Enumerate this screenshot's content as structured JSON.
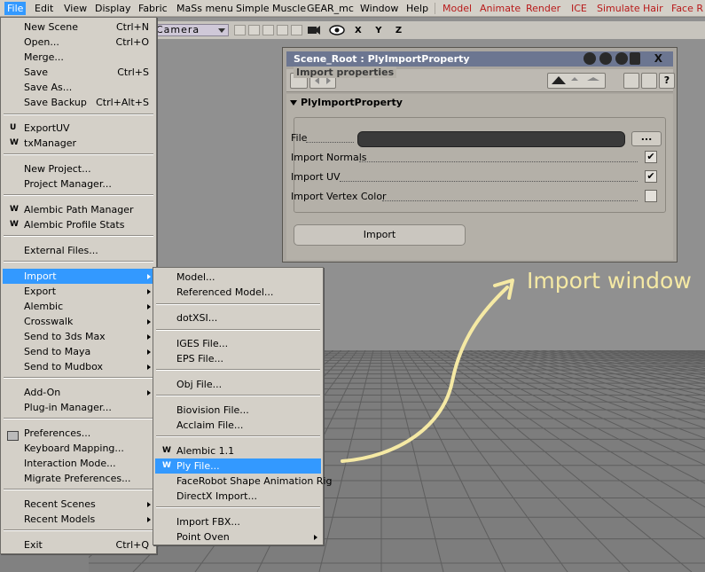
{
  "menubar": {
    "items": [
      "File",
      "Edit",
      "View",
      "Display",
      "Fabric",
      "MaSs menu",
      "Simple Muscle",
      "GEAR_mc",
      "Window",
      "Help"
    ],
    "red_items": [
      "Model",
      "Animate",
      "Render",
      "ICE",
      "Simulate",
      "Hair",
      "Face R"
    ]
  },
  "viewport": {
    "camera": "Camera",
    "axes": "X Y Z"
  },
  "file_menu": {
    "items": [
      {
        "label": "New Scene",
        "shortcut": "Ctrl+N"
      },
      {
        "label": "Open...",
        "shortcut": "Ctrl+O"
      },
      {
        "label": "Merge...",
        "shortcut": ""
      },
      {
        "label": "Save",
        "shortcut": "Ctrl+S"
      },
      {
        "label": "Save As...",
        "shortcut": ""
      },
      {
        "label": "Save Backup",
        "shortcut": "Ctrl+Alt+S"
      },
      {
        "label": "ExportUV",
        "prefix": "U"
      },
      {
        "label": "txManager",
        "prefix": "W"
      },
      {
        "label": "New Project..."
      },
      {
        "label": "Project Manager..."
      },
      {
        "label": "Alembic Path Manager",
        "prefix": "W"
      },
      {
        "label": "Alembic Profile Stats",
        "prefix": "W"
      },
      {
        "label": "External Files..."
      },
      {
        "label": "Import",
        "submenu": true,
        "highlighted": true
      },
      {
        "label": "Export",
        "submenu": true
      },
      {
        "label": "Alembic",
        "submenu": true
      },
      {
        "label": "Crosswalk",
        "submenu": true
      },
      {
        "label": "Send to 3ds Max",
        "submenu": true
      },
      {
        "label": "Send to Maya",
        "submenu": true
      },
      {
        "label": "Send to Mudbox",
        "submenu": true
      },
      {
        "label": "Add-On",
        "submenu": true
      },
      {
        "label": "Plug-in Manager..."
      },
      {
        "label": "Preferences..."
      },
      {
        "label": "Keyboard Mapping..."
      },
      {
        "label": "Interaction Mode..."
      },
      {
        "label": "Migrate Preferences..."
      },
      {
        "label": "Recent Scenes",
        "submenu": true
      },
      {
        "label": "Recent Models",
        "submenu": true
      },
      {
        "label": "Exit",
        "shortcut": "Ctrl+Q"
      }
    ]
  },
  "import_menu": {
    "items": [
      {
        "label": "Model..."
      },
      {
        "label": "Referenced Model..."
      },
      {
        "label": "dotXSI..."
      },
      {
        "label": "IGES File..."
      },
      {
        "label": "EPS File..."
      },
      {
        "label": "Obj File..."
      },
      {
        "label": "Biovision File..."
      },
      {
        "label": "Acclaim File..."
      },
      {
        "label": "Alembic 1.1",
        "prefix": "W"
      },
      {
        "label": "Ply File...",
        "prefix": "W",
        "highlighted": true
      },
      {
        "label": "FaceRobot Shape Animation Rig"
      },
      {
        "label": "DirectX Import..."
      },
      {
        "label": "Import FBX..."
      },
      {
        "label": "Point Oven",
        "submenu": true
      }
    ]
  },
  "property_window": {
    "title": "Scene_Root : PlyImportProperty",
    "close": "X",
    "section": "PlyImportProperty",
    "group": "Import properties",
    "file_label": "File",
    "file_value": "",
    "browse": "...",
    "options": [
      {
        "label": "Import Normals",
        "checked": true
      },
      {
        "label": "Import UV",
        "checked": true
      },
      {
        "label": "Import Vertex Color",
        "checked": false
      }
    ],
    "import_button": "Import"
  },
  "annotation": {
    "text": "Import window",
    "color": "#f5e9a4"
  }
}
